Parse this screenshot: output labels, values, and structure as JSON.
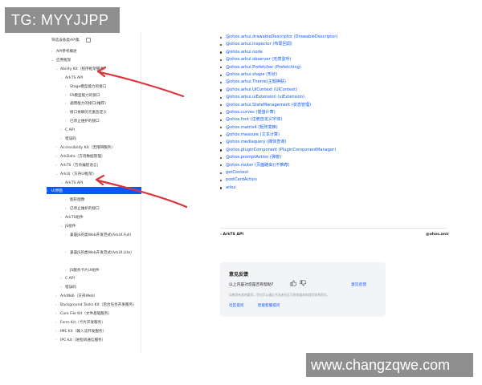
{
  "watermarks": {
    "top": "TG: MYYJJPP",
    "bottom": "www.changzqwe.com"
  },
  "sidebar": {
    "filter_label": "筛选设备类API集",
    "items": [
      {
        "label": "API参考概述",
        "level": 0,
        "arrow": "›"
      },
      {
        "label": "应用框架",
        "level": 0,
        "arrow": "⌄"
      },
      {
        "label": "Ability Kit（程序框架服务）",
        "level": 1,
        "arrow": "⌄"
      },
      {
        "label": "ArkTS API",
        "level": 2,
        "arrow": "⌄"
      },
      {
        "label": "Stage模型能力的接口",
        "level": 3,
        "arrow": "›"
      },
      {
        "label": "FA模型能力的接口",
        "level": 3,
        "arrow": "›"
      },
      {
        "label": "通用能力的接口(推荐)",
        "level": 3,
        "arrow": "›"
      },
      {
        "label": "接口依赖的元素及定义",
        "level": 3,
        "arrow": "›"
      },
      {
        "label": "已停止维护的接口",
        "level": 3,
        "arrow": "›"
      },
      {
        "label": "C API",
        "level": 2,
        "arrow": "›"
      },
      {
        "label": "错误码",
        "level": 2,
        "arrow": "›"
      },
      {
        "label": "Accessibility Kit（无障碍服务）",
        "level": 1,
        "arrow": "›"
      },
      {
        "label": "ArkData（方舟数据管理）",
        "level": 1,
        "arrow": "›"
      },
      {
        "label": "ArkTS（方舟编程语言）",
        "level": 1,
        "arrow": "›"
      },
      {
        "label": "ArkUI（方舟UI框架）",
        "level": 1,
        "arrow": "⌄"
      },
      {
        "label": "ArkTS API",
        "level": 2,
        "arrow": "⌄"
      },
      {
        "label": "UI界面",
        "level": 3,
        "arrow": "›",
        "active": true
      },
      {
        "label": "图形图像",
        "level": 3,
        "arrow": "›"
      },
      {
        "label": "已停止维护的接口",
        "level": 3,
        "arrow": "›"
      },
      {
        "label": "ArkTS组件",
        "level": 2,
        "arrow": "›"
      },
      {
        "label": "JS组件",
        "level": 2,
        "arrow": "⌄"
      },
      {
        "label": "兼容JS的类Web开发范式(ArkUI.Full)",
        "level": 3,
        "arrow": "›"
      },
      {
        "label": "",
        "level": 3,
        "arrow": ""
      },
      {
        "label": "兼容JS的类Web开发范式(ArkUI.Lite)",
        "level": 3,
        "arrow": "›"
      },
      {
        "label": "",
        "level": 3,
        "arrow": ""
      },
      {
        "label": "JS服务卡片UI组件",
        "level": 3,
        "arrow": "›"
      },
      {
        "label": "C API",
        "level": 2,
        "arrow": "›"
      },
      {
        "label": "错误码",
        "level": 2,
        "arrow": "›"
      },
      {
        "label": "ArkWeb（方舟Web）",
        "level": 1,
        "arrow": "›"
      },
      {
        "label": "Background Tasks Kit（后台任务开发服务）",
        "level": 1,
        "arrow": "›"
      },
      {
        "label": "Core File Kit（文件基础服务）",
        "level": 1,
        "arrow": "›"
      },
      {
        "label": "Form Kit（卡片开发服务）",
        "level": 1,
        "arrow": "›"
      },
      {
        "label": "IME Kit（输入法开发服务）",
        "level": 1,
        "arrow": "›"
      },
      {
        "label": "IPC Kit（进程间通信服务）",
        "level": 1,
        "arrow": "›"
      }
    ]
  },
  "api_list": [
    "@ohos.arkui.drawableDescriptor (DrawableDescriptor)",
    "@ohos.arkui.inspector (布局回调)",
    "@ohos.arkui.node",
    "@ohos.arkui.observer (无感监听)",
    "@ohos.arkui.Prefetcher (Prefetching)",
    "@ohos.arkui.shape (形状)",
    "@ohos.arkui.Theme(主题换肤)",
    "@ohos.arkui.UIContext (UIContext)",
    "@ohos.arkui.uiExtension (uiExtension)",
    "@ohos.arkui.StateManagement (状态管理)",
    "@ohos.curves (插值计算)",
    "@ohos.font (注册自定义字体)",
    "@ohos.matrix4 (矩阵变换)",
    "@ohos.measure (文本计算)",
    "@ohos.mediaquery (媒体查询)",
    "@ohos.pluginComponent (PluginComponentManager)",
    "@ohos.promptAction (弹窗)",
    "@ohos.router (页面路由)(不推荐)",
    "getContext",
    "postCardAction",
    "arkui"
  ],
  "pagination": {
    "prev": "‹ ArkTS API",
    "next": "@ohos.anir"
  },
  "feedback": {
    "title": "意见反馈",
    "question": "以上内容对您是否有帮助?",
    "link": "意见反馈",
    "note": "如果您有其他疑问，您也可以通过开发者社区问答频道来和我们联系探讨。",
    "action_community": "社区提问",
    "action_smart": "智能客服提问"
  },
  "colors": {
    "accent": "#0a59f7",
    "annotation": "#d9363e"
  }
}
